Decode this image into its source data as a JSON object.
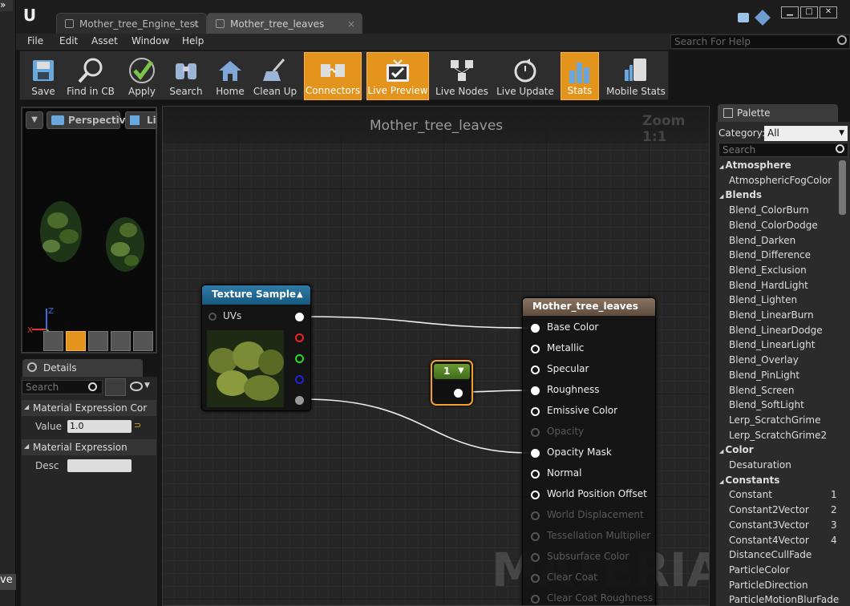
{
  "tabs": [
    {
      "label": "Mother_tree_Engine_test"
    },
    {
      "label": "Mother_tree_leaves"
    }
  ],
  "menu": [
    "File",
    "Edit",
    "Asset",
    "Window",
    "Help"
  ],
  "help_search_placeholder": "Search For Help",
  "toolbar": [
    {
      "label": "Save",
      "icon": "save-icon"
    },
    {
      "label": "Find in CB",
      "icon": "magnifier-icon"
    },
    {
      "label": "Apply",
      "icon": "checkmark-icon"
    },
    {
      "label": "Search",
      "icon": "binoculars-icon"
    },
    {
      "label": "Home",
      "icon": "home-icon"
    },
    {
      "label": "Clean Up",
      "icon": "broom-icon"
    },
    {
      "label": "Connectors",
      "icon": "connectors-icon",
      "active": true
    },
    {
      "label": "Live Preview",
      "icon": "tv-icon",
      "active": true
    },
    {
      "label": "Live Nodes",
      "icon": "nodes-icon"
    },
    {
      "label": "Live Update",
      "icon": "refresh-icon"
    },
    {
      "label": "Stats",
      "icon": "bar-chart-icon",
      "active": true
    },
    {
      "label": "Mobile Stats",
      "icon": "mobile-icon"
    }
  ],
  "viewport": {
    "perspective_label": "Perspective",
    "lit_label": "Li"
  },
  "details": {
    "tab_label": "Details",
    "search_placeholder": "Search",
    "section1": "Material Expression Cor",
    "value_label": "Value",
    "value": "1.0",
    "section2": "Material Expression",
    "desc_label": "Desc"
  },
  "graph": {
    "title": "Mother_tree_leaves",
    "zoom": "Zoom 1:1",
    "watermark": "MATERIAL"
  },
  "texture_node": {
    "title": "Texture Sample",
    "input": "UVs"
  },
  "constant_node": {
    "value": "1"
  },
  "material_node": {
    "title": "Mother_tree_leaves",
    "pins": [
      {
        "label": "Base Color",
        "connected": true,
        "enabled": true
      },
      {
        "label": "Metallic",
        "connected": false,
        "enabled": true
      },
      {
        "label": "Specular",
        "connected": false,
        "enabled": true
      },
      {
        "label": "Roughness",
        "connected": true,
        "enabled": true
      },
      {
        "label": "Emissive Color",
        "connected": false,
        "enabled": true
      },
      {
        "label": "Opacity",
        "connected": false,
        "enabled": false
      },
      {
        "label": "Opacity Mask",
        "connected": true,
        "enabled": true
      },
      {
        "label": "Normal",
        "connected": false,
        "enabled": true
      },
      {
        "label": "World Position Offset",
        "connected": false,
        "enabled": true
      },
      {
        "label": "World Displacement",
        "connected": false,
        "enabled": false
      },
      {
        "label": "Tessellation Multiplier",
        "connected": false,
        "enabled": false
      },
      {
        "label": "Subsurface Color",
        "connected": false,
        "enabled": false
      },
      {
        "label": "Clear Coat",
        "connected": false,
        "enabled": false
      },
      {
        "label": "Clear Coat Roughness",
        "connected": false,
        "enabled": false
      }
    ]
  },
  "palette": {
    "tab_label": "Palette",
    "category_label": "Category:",
    "category_value": "All",
    "search_placeholder": "Search",
    "entries": [
      {
        "type": "cat",
        "label": "Atmosphere"
      },
      {
        "type": "item",
        "label": "AtmosphericFogColor"
      },
      {
        "type": "cat",
        "label": "Blends"
      },
      {
        "type": "item",
        "label": "Blend_ColorBurn"
      },
      {
        "type": "item",
        "label": "Blend_ColorDodge"
      },
      {
        "type": "item",
        "label": "Blend_Darken"
      },
      {
        "type": "item",
        "label": "Blend_Difference"
      },
      {
        "type": "item",
        "label": "Blend_Exclusion"
      },
      {
        "type": "item",
        "label": "Blend_HardLight"
      },
      {
        "type": "item",
        "label": "Blend_Lighten"
      },
      {
        "type": "item",
        "label": "Blend_LinearBurn"
      },
      {
        "type": "item",
        "label": "Blend_LinearDodge"
      },
      {
        "type": "item",
        "label": "Blend_LinearLight"
      },
      {
        "type": "item",
        "label": "Blend_Overlay"
      },
      {
        "type": "item",
        "label": "Blend_PinLight"
      },
      {
        "type": "item",
        "label": "Blend_Screen"
      },
      {
        "type": "item",
        "label": "Blend_SoftLight"
      },
      {
        "type": "item",
        "label": "Lerp_ScratchGrime"
      },
      {
        "type": "item",
        "label": "Lerp_ScratchGrime2"
      },
      {
        "type": "cat",
        "label": "Color"
      },
      {
        "type": "item",
        "label": "Desaturation"
      },
      {
        "type": "cat",
        "label": "Constants"
      },
      {
        "type": "item",
        "label": "Constant",
        "hotkey": "1"
      },
      {
        "type": "item",
        "label": "Constant2Vector",
        "hotkey": "2"
      },
      {
        "type": "item",
        "label": "Constant3Vector",
        "hotkey": "3"
      },
      {
        "type": "item",
        "label": "Constant4Vector",
        "hotkey": "4"
      },
      {
        "type": "item",
        "label": "DistanceCullFade"
      },
      {
        "type": "item",
        "label": "ParticleColor"
      },
      {
        "type": "item",
        "label": "ParticleDirection"
      },
      {
        "type": "item",
        "label": "ParticleMotionBlurFade"
      }
    ]
  },
  "bottom_left_text": "ve"
}
